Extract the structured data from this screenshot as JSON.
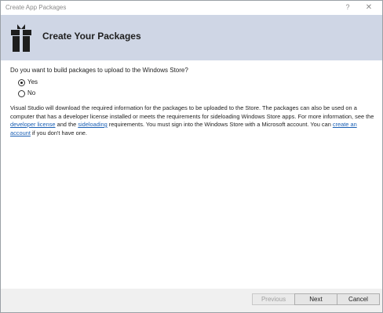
{
  "window": {
    "title": "Create App Packages",
    "help_glyph": "?",
    "close_glyph": "✕"
  },
  "header": {
    "title": "Create Your Packages",
    "icon": "gift-package-icon"
  },
  "question": "Do you want to build packages to upload to the Windows Store?",
  "options": [
    {
      "label": "Yes",
      "selected": true
    },
    {
      "label": "No",
      "selected": false
    }
  ],
  "info": {
    "text_1": "Visual Studio will download the required information for the packages to be uploaded to the Store. The packages can also be used on a computer that has a developer license installed or meets the requirements for sideloading Windows Store apps. For more information, see the ",
    "link_developer_license": "developer license",
    "text_2": " and the ",
    "link_sideloading": "sideloading",
    "text_3": " requirements. You must sign into the Windows Store with a Microsoft account. You can ",
    "link_create_account": "create an account",
    "text_4": " if you don't have one."
  },
  "buttons": {
    "previous": "Previous",
    "next": "Next",
    "cancel": "Cancel"
  },
  "colors": {
    "header_bg": "#cfd6e5",
    "link": "#1a5fb4",
    "footer_bg": "#f0f0f0"
  }
}
